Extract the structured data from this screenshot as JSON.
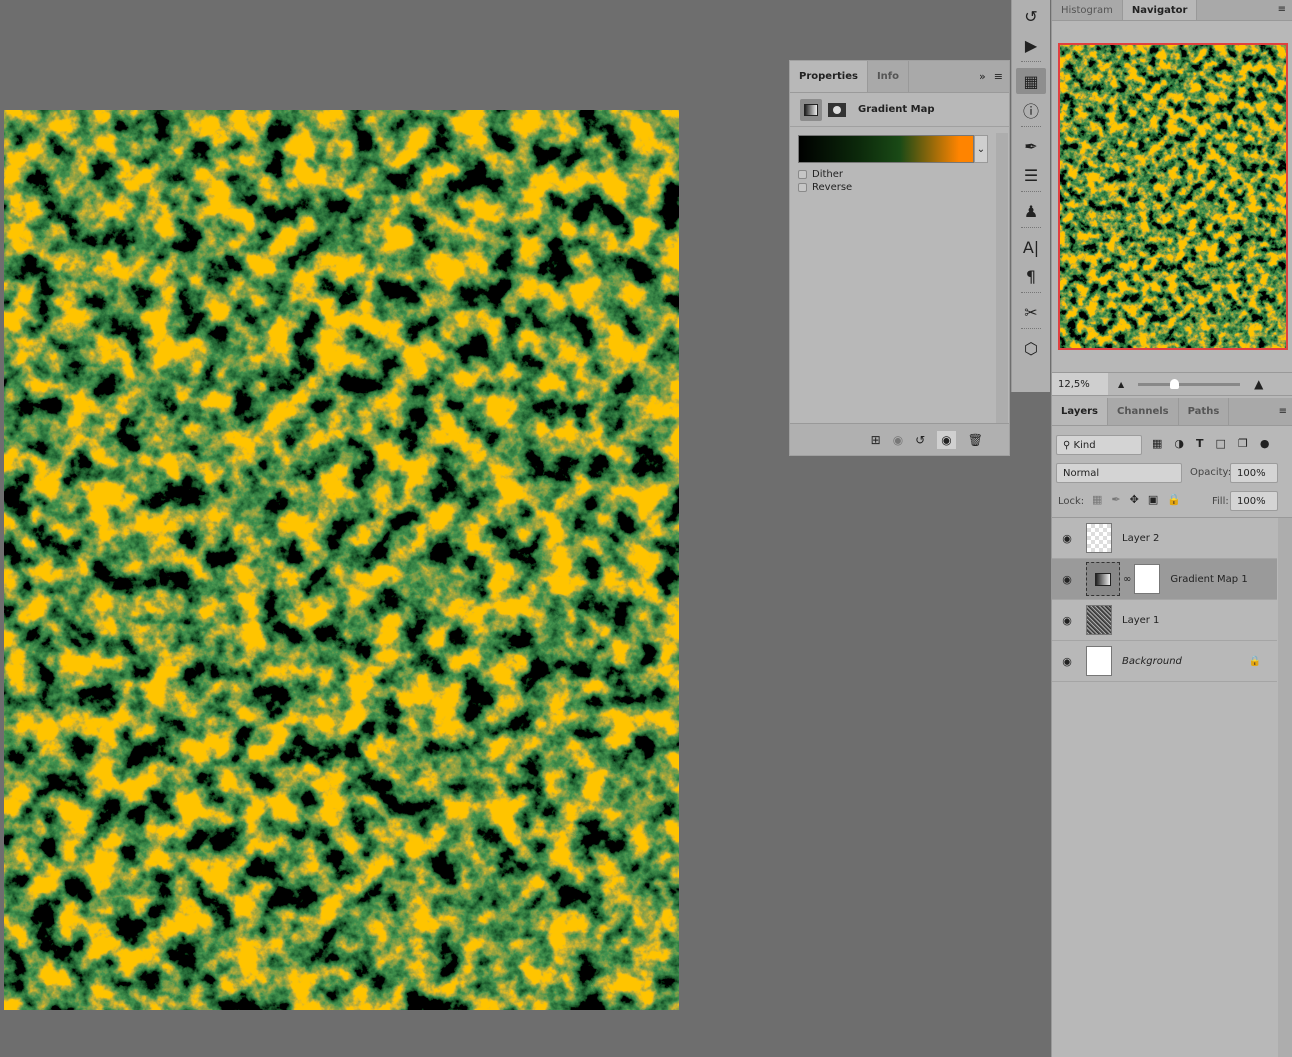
{
  "properties": {
    "tabs": [
      "Properties",
      "Info"
    ],
    "title": "Gradient Map",
    "dither": "Dither",
    "reverse": "Reverse",
    "gradient_colors": [
      "#000000",
      "#1a4a16",
      "#ff8400"
    ],
    "dither_checked": false,
    "reverse_checked": false
  },
  "navigator": {
    "tabs": [
      "Histogram",
      "Navigator"
    ],
    "zoom": "12,5%",
    "zoom_slider_fraction": 0.25,
    "view_box_color": "#e04040"
  },
  "layers_panel": {
    "tabs": [
      "Layers",
      "Channels",
      "Paths"
    ],
    "filter": "Kind",
    "blend_mode": "Normal",
    "opacity_label": "Opacity:",
    "opacity": "100%",
    "lock_label": "Lock:",
    "fill_label": "Fill:",
    "fill": "100%",
    "layers": [
      {
        "name": "Layer 2",
        "type": "transparent"
      },
      {
        "name": "Gradient Map 1",
        "type": "adjustment",
        "selected": true
      },
      {
        "name": "Layer 1",
        "type": "noise"
      },
      {
        "name": "Background",
        "type": "white",
        "locked": true
      }
    ]
  }
}
